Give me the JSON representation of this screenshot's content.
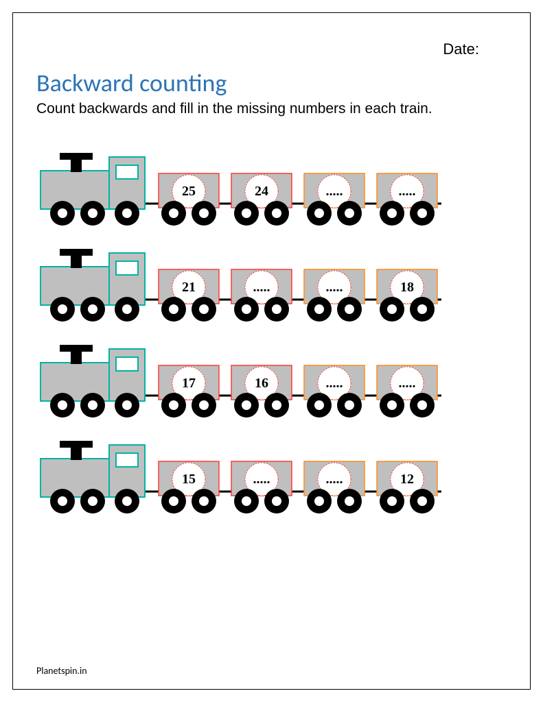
{
  "header": {
    "date_label": "Date:"
  },
  "title": "Backward counting",
  "instructions": "Count backwards and fill in the missing numbers in each train.",
  "trains": [
    {
      "cars": [
        "25",
        "24",
        ".....",
        "....."
      ]
    },
    {
      "cars": [
        "21",
        ".....",
        ".....",
        "18"
      ]
    },
    {
      "cars": [
        "17",
        "16",
        ".....",
        "....."
      ]
    },
    {
      "cars": [
        "15",
        ".....",
        ".....",
        "12"
      ]
    }
  ],
  "footer": "Planetspin.in",
  "colors": {
    "title": "#2e74b5",
    "body": "#bfbfbf",
    "outline_teal": "#00b3a4",
    "outline_red": "#ff3b30",
    "outline_orange": "#ff8c1a",
    "wheel": "#000000"
  }
}
